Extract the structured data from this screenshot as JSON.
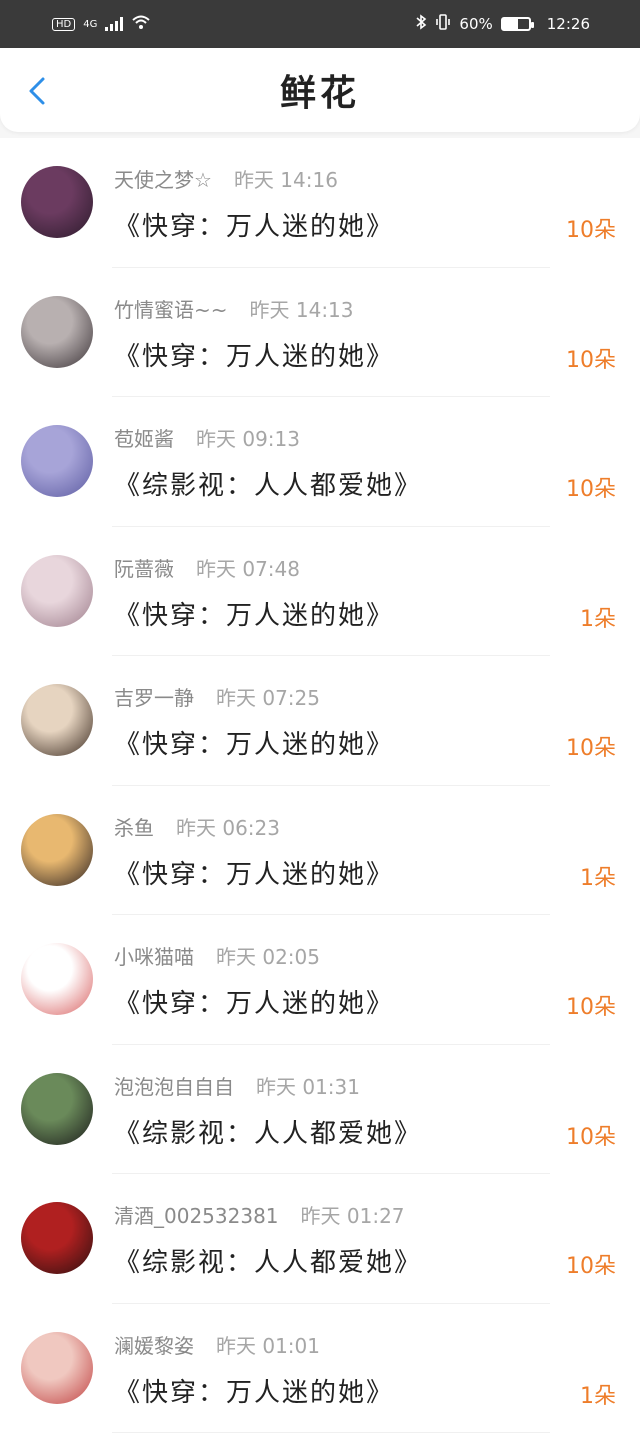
{
  "status_bar": {
    "hd": "HD",
    "network": "4G",
    "battery_text": "60%",
    "battery_level": 0.6,
    "time": "12:26"
  },
  "header": {
    "title": "鲜花"
  },
  "rows": [
    {
      "name": "天使之梦☆",
      "time": "昨天 14:16",
      "book": "《快穿：万人迷的她》",
      "count": "10朵",
      "avatar_colors": [
        "#6b3b60",
        "#2a1a2a"
      ]
    },
    {
      "name": "竹情蜜语~~",
      "time": "昨天 14:13",
      "book": "《快穿：万人迷的她》",
      "count": "10朵",
      "avatar_colors": [
        "#b8b0b0",
        "#3a3236"
      ]
    },
    {
      "name": "苞姬酱",
      "time": "昨天 09:13",
      "book": "《综影视：人人都爱她》",
      "count": "10朵",
      "avatar_colors": [
        "#a7a4d8",
        "#5b5aa0"
      ]
    },
    {
      "name": "阮蔷薇",
      "time": "昨天 07:48",
      "book": "《快穿：万人迷的她》",
      "count": "1朵",
      "avatar_colors": [
        "#e8d6dc",
        "#9c7c8a"
      ]
    },
    {
      "name": "吉罗一静",
      "time": "昨天 07:25",
      "book": "《快穿：万人迷的她》",
      "count": "10朵",
      "avatar_colors": [
        "#e6d4c0",
        "#3a2a20"
      ]
    },
    {
      "name": "杀鱼",
      "time": "昨天 06:23",
      "book": "《快穿：万人迷的她》",
      "count": "1朵",
      "avatar_colors": [
        "#e8b870",
        "#2a2020"
      ]
    },
    {
      "name": "小咪猫喵",
      "time": "昨天 02:05",
      "book": "《快穿：万人迷的她》",
      "count": "10朵",
      "avatar_colors": [
        "#ffffff",
        "#d86060"
      ]
    },
    {
      "name": "泡泡泡自自自",
      "time": "昨天 01:31",
      "book": "《综影视：人人都爱她》",
      "count": "10朵",
      "avatar_colors": [
        "#6a8a5a",
        "#1a1a1a"
      ]
    },
    {
      "name": "清酒_002532381",
      "time": "昨天 01:27",
      "book": "《综影视：人人都爱她》",
      "count": "10朵",
      "avatar_colors": [
        "#b02020",
        "#2a1010"
      ]
    },
    {
      "name": "澜媛黎姿",
      "time": "昨天 01:01",
      "book": "《快穿：万人迷的她》",
      "count": "1朵",
      "avatar_colors": [
        "#f0c8c0",
        "#c04040"
      ]
    }
  ]
}
